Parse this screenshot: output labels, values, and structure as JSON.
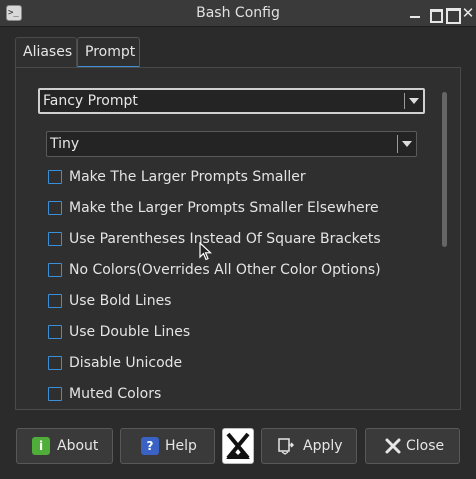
{
  "window": {
    "title": "Bash Config"
  },
  "tabs": [
    {
      "label": "Aliases",
      "selected": false
    },
    {
      "label": "Prompt",
      "selected": true
    }
  ],
  "prompt_style": {
    "selected": "Fancy Prompt"
  },
  "prompt_size": {
    "selected": "Tiny"
  },
  "options": [
    {
      "label": "Make The Larger Prompts Smaller",
      "checked": false
    },
    {
      "label": "Make the Larger Prompts Smaller Elsewhere",
      "checked": false
    },
    {
      "label": "Use Parentheses Instead Of Square Brackets",
      "checked": false
    },
    {
      "label": "No Colors(Overrides All Other Color Options)",
      "checked": false
    },
    {
      "label": "Use Bold Lines",
      "checked": false
    },
    {
      "label": "Use Double Lines",
      "checked": false
    },
    {
      "label": "Disable Unicode",
      "checked": false
    },
    {
      "label": "Muted Colors",
      "checked": false
    }
  ],
  "buttons": {
    "about": "About",
    "help": "Help",
    "apply": "Apply",
    "close": "Close"
  },
  "colors": {
    "accent": "#3b8fd9",
    "background": "#2b2b2b",
    "about_icon": "#4fae3a",
    "help_icon": "#3a62c4"
  },
  "icons": {
    "app": "terminal-icon",
    "about": "info-icon",
    "help": "question-icon",
    "mx": "mx-logo-icon",
    "apply": "apply-icon",
    "close": "x-icon"
  }
}
